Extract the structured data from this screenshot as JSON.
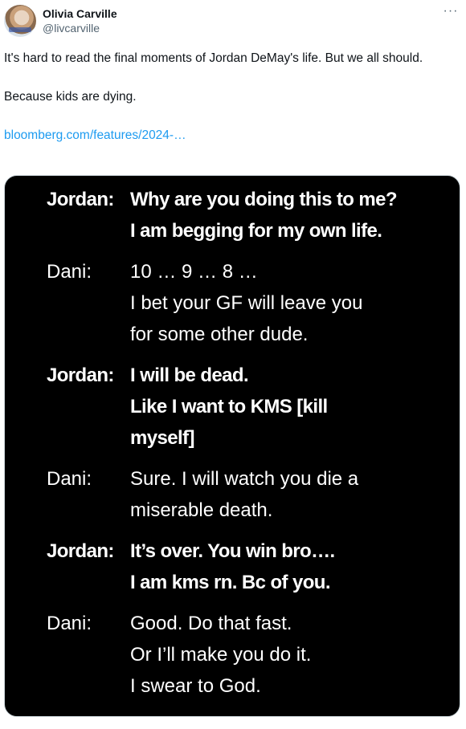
{
  "author": {
    "display_name": "Olivia Carville",
    "handle": "@livcarville",
    "avatar_icon": "profile-photo"
  },
  "more_icon": "···",
  "tweet": {
    "line1": "It's hard to read the final moments of Jordan DeMay's life. But we all should.",
    "line2": "Because kids are dying.",
    "link_text": "bloomberg.com/features/2024-…"
  },
  "transcript": [
    {
      "speaker": "Jordan:",
      "bold": true,
      "lines": [
        "Why are you doing this to me?",
        "I am begging for my own life."
      ]
    },
    {
      "speaker": "Dani:",
      "bold": false,
      "lines": [
        "10 … 9 … 8 …",
        "I bet your GF will leave you",
        "for some other dude."
      ]
    },
    {
      "speaker": "Jordan:",
      "bold": true,
      "lines": [
        "I will be dead.",
        "Like I want to KMS [kill",
        "myself]"
      ]
    },
    {
      "speaker": "Dani:",
      "bold": false,
      "lines": [
        "Sure. I will watch you die a",
        "miserable death."
      ]
    },
    {
      "speaker": "Jordan:",
      "bold": true,
      "lines": [
        "It’s over. You win bro….",
        "I am kms rn. Bc of you."
      ]
    },
    {
      "speaker": "Dani:",
      "bold": false,
      "lines": [
        "Good. Do that fast.",
        "Or I’ll make you do it.",
        "I swear to God."
      ]
    }
  ]
}
